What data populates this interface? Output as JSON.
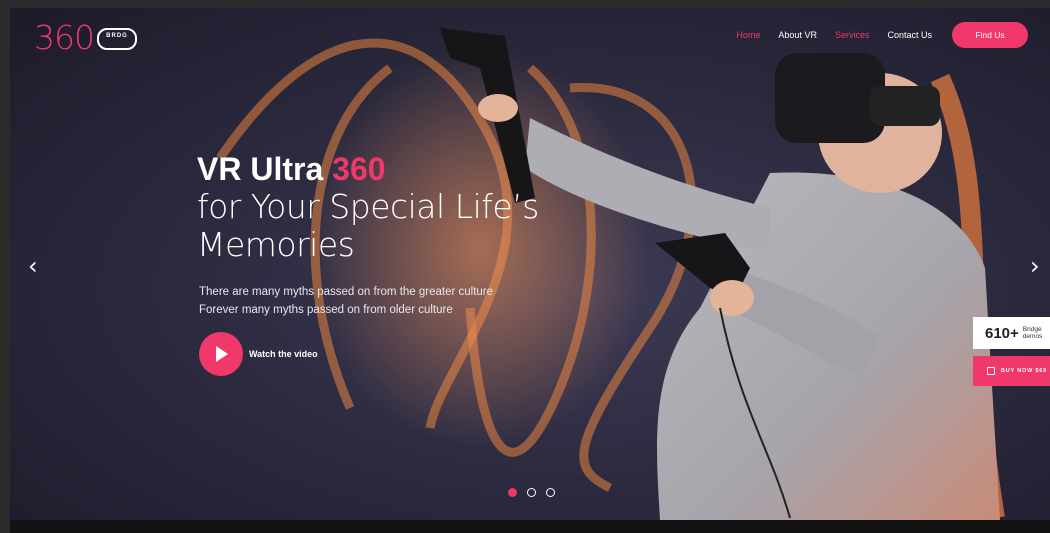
{
  "logo": {
    "number": "360",
    "mark_text": "BRDG"
  },
  "nav": {
    "items": [
      "Home",
      "About VR",
      "Services",
      "Contact Us"
    ],
    "active": "Home"
  },
  "find_button": "Find Us",
  "hero": {
    "title_part1": "VR Ultra ",
    "title_accent": "360",
    "title_line2": "for Your Special Life’s",
    "title_line3": "Memories",
    "sub_line1": "There are many myths passed on from the greater culture",
    "sub_line2": "Forever many myths passed on from older culture",
    "watch_label": "Watch the video"
  },
  "slider": {
    "prev": "‹",
    "next": "›",
    "active_slide": 1,
    "total_slides": 3
  },
  "side": {
    "demos_count": "610+",
    "demos_label_1": "Bridge",
    "demos_label_2": "demos",
    "buy_label": "BUY NOW $69"
  },
  "colors": {
    "accent": "#f0386b",
    "background": "#2a283c"
  }
}
